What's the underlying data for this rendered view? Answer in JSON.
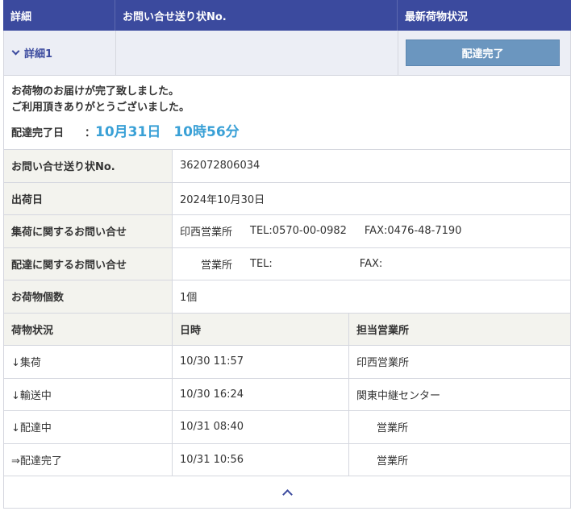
{
  "header": {
    "col_detail": "詳細",
    "col_tracking": "お問い合せ送り状No.",
    "col_status": "最新荷物状況"
  },
  "detail_row": {
    "toggle_label": "詳細1",
    "status_button": "配達完了"
  },
  "message": {
    "line1": "お荷物のお届けが完了致しました。",
    "line2": "ご利用頂きありがとうございました。",
    "delivery_label": "配達完了日",
    "colon": "：",
    "delivery_date": "10月31日",
    "delivery_time": "10時56分"
  },
  "info": {
    "tracking_label": "お問い合せ送り状No.",
    "tracking_value": "362072806034",
    "ship_date_label": "出荷日",
    "ship_date_value": "2024年10月30日",
    "pickup_label": "集荷に関するお問い合せ",
    "pickup_office": "印西営業所",
    "pickup_tel": "TEL:0570-00-0982",
    "pickup_fax": "FAX:0476-48-7190",
    "delivery_label": "配達に関するお問い合せ",
    "delivery_office": "営業所",
    "delivery_tel": "TEL:",
    "delivery_fax": "FAX:",
    "count_label": "お荷物個数",
    "count_value": "1個"
  },
  "history": {
    "col_status": "荷物状況",
    "col_datetime": "日時",
    "col_office": "担当営業所",
    "rows": [
      {
        "status": "↓集荷",
        "datetime": "10/30 11:57",
        "office": "印西営業所"
      },
      {
        "status": "↓輸送中",
        "datetime": "10/30 16:24",
        "office": "関東中継センター"
      },
      {
        "status": "↓配達中",
        "datetime": "10/31 08:40",
        "office": "営業所"
      },
      {
        "status": "⇒配達完了",
        "datetime": "10/31 10:56",
        "office": "営業所"
      }
    ]
  },
  "icons": {
    "toggle": "chevron-down-icon",
    "collapse": "chevron-up-icon"
  },
  "colors": {
    "header_bg": "#3b4a9e",
    "button_bg": "#6b96bf",
    "date_accent": "#39a0d6"
  }
}
